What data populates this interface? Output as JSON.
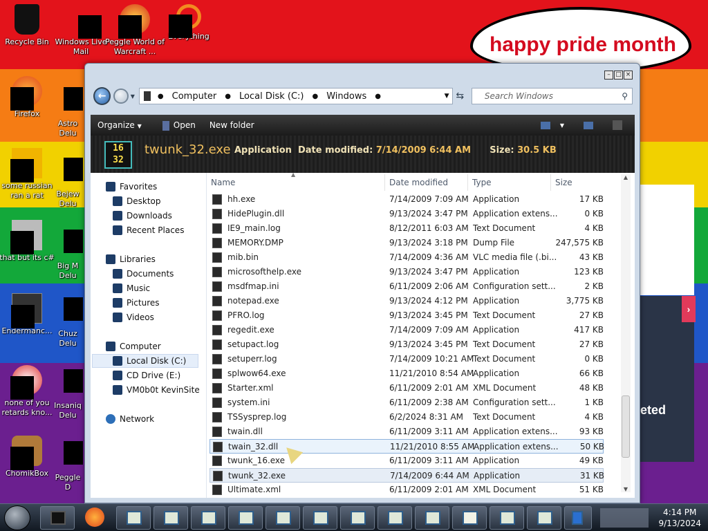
{
  "desktop": {
    "speech_text": "happy pride month",
    "icons": [
      {
        "label": "Recycle Bin"
      },
      {
        "label": "Windows Live Mail"
      },
      {
        "label": "Peggle World of Warcraft ..."
      },
      {
        "label": "Everything"
      },
      {
        "label": "Firefox"
      },
      {
        "label": "Astro Delu"
      },
      {
        "label": "some russian ran a rat"
      },
      {
        "label": "Bejew Delu"
      },
      {
        "label": "that but its c#"
      },
      {
        "label": "Big M Delu"
      },
      {
        "label": "Endermanc..."
      },
      {
        "label": "Chuz Delu"
      },
      {
        "label": "none of you retards kno..."
      },
      {
        "label": "Insaniq Delu"
      },
      {
        "label": "ChomikBox"
      },
      {
        "label": "Peggle D"
      }
    ],
    "side_panel_text": "eted"
  },
  "window": {
    "title_buttons": [
      "minimize",
      "maximize",
      "close"
    ],
    "breadcrumb": [
      "Computer",
      "Local Disk (C:)",
      "Windows"
    ],
    "search_placeholder": "Search Windows",
    "toolbar": {
      "organize": "Organize",
      "open": "Open",
      "new_folder": "New folder"
    },
    "details": {
      "icon_text_top": "16",
      "icon_text_bottom": "32",
      "filename": "twunk_32.exe",
      "type": "Application",
      "date_label": "Date modified:",
      "date": "7/14/2009 6:44 AM",
      "size_label": "Size:",
      "size": "30.5 KB"
    },
    "nav": {
      "favorites": "Favorites",
      "desktop": "Desktop",
      "downloads": "Downloads",
      "recent": "Recent Places",
      "libraries": "Libraries",
      "documents": "Documents",
      "music": "Music",
      "pictures": "Pictures",
      "videos": "Videos",
      "computer": "Computer",
      "local_disk": "Local Disk (C:)",
      "cd_drive": "CD Drive (E:)",
      "share": "VM0b0t KevinSite",
      "network": "Network"
    },
    "columns": {
      "name": "Name",
      "date": "Date modified",
      "type": "Type",
      "size": "Size"
    },
    "files": [
      {
        "name": "hh.exe",
        "date": "7/14/2009 7:09 AM",
        "type": "Application",
        "size": "17 KB"
      },
      {
        "name": "HidePlugin.dll",
        "date": "9/13/2024 3:47 PM",
        "type": "Application extens...",
        "size": "0 KB"
      },
      {
        "name": "IE9_main.log",
        "date": "8/12/2011 6:03 AM",
        "type": "Text Document",
        "size": "4 KB"
      },
      {
        "name": "MEMORY.DMP",
        "date": "9/13/2024 3:18 PM",
        "type": "Dump File",
        "size": "247,575 KB"
      },
      {
        "name": "mib.bin",
        "date": "7/14/2009 4:36 AM",
        "type": "VLC media file (.bi...",
        "size": "43 KB"
      },
      {
        "name": "microsofthelp.exe",
        "date": "9/13/2024 3:47 PM",
        "type": "Application",
        "size": "123 KB"
      },
      {
        "name": "msdfmap.ini",
        "date": "6/11/2009 2:06 AM",
        "type": "Configuration sett...",
        "size": "2 KB"
      },
      {
        "name": "notepad.exe",
        "date": "9/13/2024 4:12 PM",
        "type": "Application",
        "size": "3,775 KB"
      },
      {
        "name": "PFRO.log",
        "date": "9/13/2024 3:45 PM",
        "type": "Text Document",
        "size": "27 KB"
      },
      {
        "name": "regedit.exe",
        "date": "7/14/2009 7:09 AM",
        "type": "Application",
        "size": "417 KB"
      },
      {
        "name": "setupact.log",
        "date": "9/13/2024 3:45 PM",
        "type": "Text Document",
        "size": "27 KB"
      },
      {
        "name": "setuperr.log",
        "date": "7/14/2009 10:21 AM",
        "type": "Text Document",
        "size": "0 KB"
      },
      {
        "name": "splwow64.exe",
        "date": "11/21/2010 8:54 AM",
        "type": "Application",
        "size": "66 KB"
      },
      {
        "name": "Starter.xml",
        "date": "6/11/2009 2:01 AM",
        "type": "XML Document",
        "size": "48 KB"
      },
      {
        "name": "system.ini",
        "date": "6/11/2009 2:38 AM",
        "type": "Configuration sett...",
        "size": "1 KB"
      },
      {
        "name": "TSSysprep.log",
        "date": "6/2/2024 8:31 AM",
        "type": "Text Document",
        "size": "4 KB"
      },
      {
        "name": "twain.dll",
        "date": "6/11/2009 3:11 AM",
        "type": "Application extens...",
        "size": "93 KB"
      },
      {
        "name": "twain_32.dll",
        "date": "11/21/2010 8:55 AM",
        "type": "Application extens...",
        "size": "50 KB"
      },
      {
        "name": "twunk_16.exe",
        "date": "6/11/2009 3:11 AM",
        "type": "Application",
        "size": "49 KB"
      },
      {
        "name": "twunk_32.exe",
        "date": "7/14/2009 6:44 AM",
        "type": "Application",
        "size": "31 KB"
      },
      {
        "name": "Ultimate.xml",
        "date": "6/11/2009 2:01 AM",
        "type": "XML Document",
        "size": "51 KB"
      }
    ]
  },
  "taskbar": {
    "time": "4:14 PM",
    "date": "9/13/2024"
  }
}
